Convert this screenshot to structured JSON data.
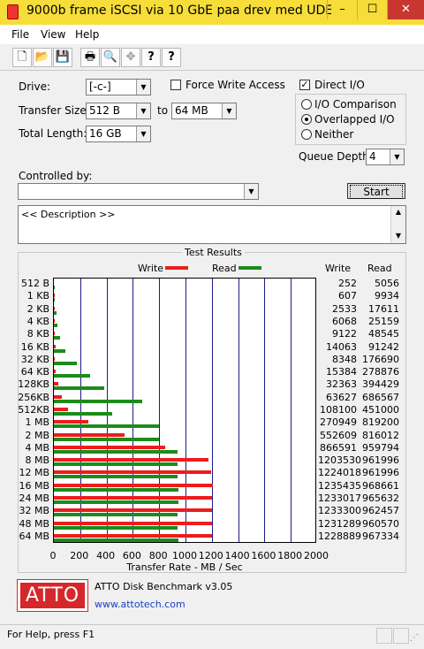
{
  "window": {
    "title": "9000b frame iSCSI via 10 GbE paa drev med UDEN...",
    "minimize": "–",
    "maximize": "☐",
    "close": "✕"
  },
  "menu": {
    "file": "File",
    "view": "View",
    "help": "Help"
  },
  "toolbar": {
    "icons": [
      "new-icon",
      "open-icon",
      "save-icon",
      "print-icon",
      "print-preview-icon",
      "move-icon",
      "help-icon",
      "context-help-icon"
    ],
    "glyphs": [
      "🗋",
      "📂",
      "💾",
      "🖶",
      "🔍",
      "✥",
      "?",
      "?"
    ]
  },
  "settings": {
    "drive_label": "Drive:",
    "drive_value": "[-c-]",
    "force_write_label": "Force Write Access",
    "force_write_checked": false,
    "direct_io_label": "Direct I/O",
    "direct_io_checked": true,
    "transfer_size_label": "Transfer Size:",
    "transfer_from": "512 B",
    "to_label": "to",
    "transfer_to": "64 MB",
    "total_length_label": "Total Length:",
    "total_length_value": "16 GB",
    "io_comparison_label": "I/O Comparison",
    "overlapped_io_label": "Overlapped I/O",
    "neither_label": "Neither",
    "selected_mode": "overlapped",
    "queue_depth_label": "Queue Depth:",
    "queue_depth_value": "4",
    "controlled_by_label": "Controlled by:",
    "controlled_by_value": "",
    "start_label": "Start",
    "description_text": "<< Description >>"
  },
  "results": {
    "group_label": "Test Results",
    "write_legend": "Write",
    "read_legend": "Read",
    "write_col_header": "Write",
    "read_col_header": "Read",
    "xlabel": "Transfer Rate - MB / Sec",
    "write_color": "#ee1c1c",
    "read_color": "#1c8c1c"
  },
  "chart_data": {
    "type": "bar",
    "orientation": "horizontal",
    "title": "Test Results",
    "xlabel": "Transfer Rate - MB / Sec",
    "xlim": [
      0,
      2000
    ],
    "xticks": [
      0,
      200,
      400,
      600,
      800,
      1000,
      1200,
      1400,
      1600,
      1800,
      2000
    ],
    "grid": true,
    "legend": "top-center",
    "categories": [
      "512 B",
      "1 KB",
      "2 KB",
      "4 KB",
      "8 KB",
      "16 KB",
      "32 KB",
      "64 KB",
      "128KB",
      "256KB",
      "512KB",
      "1 MB",
      "2 MB",
      "4 MB",
      "8 MB",
      "12 MB",
      "16 MB",
      "24 MB",
      "32 MB",
      "48 MB",
      "64 MB"
    ],
    "series": [
      {
        "name": "Write",
        "values_kbps": [
          252,
          607,
          2533,
          6068,
          9122,
          14063,
          8348,
          15384,
          32363,
          63627,
          108100,
          270949,
          552609,
          866591,
          1203530,
          1224018,
          1235435,
          1233017,
          1233300,
          1231289,
          1228889
        ]
      },
      {
        "name": "Read",
        "values_kbps": [
          5056,
          9934,
          17611,
          25159,
          48545,
          91242,
          176690,
          278876,
          394429,
          686567,
          451000,
          819200,
          816012,
          959794,
          961996,
          961996,
          968661,
          965632,
          962457,
          960570,
          967334
        ]
      }
    ]
  },
  "branding": {
    "logo_text": "ATTO",
    "product": "ATTO Disk Benchmark v3.05",
    "url": "www.attotech.com"
  },
  "status": {
    "text": "For Help, press F1"
  }
}
